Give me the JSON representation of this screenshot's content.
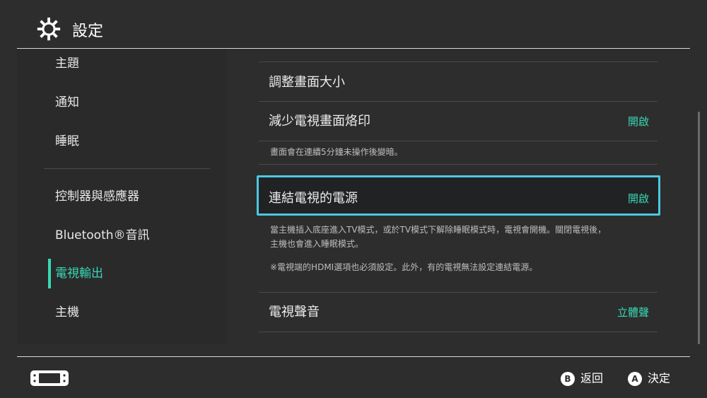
{
  "header": {
    "title": "設定",
    "icon": "gear-icon"
  },
  "sidebar": {
    "items": [
      {
        "label": "主題"
      },
      {
        "label": "通知"
      },
      {
        "label": "睡眠"
      },
      {
        "label": "控制器與感應器"
      },
      {
        "label": "Bluetooth®音訊"
      },
      {
        "label": "電視輸出",
        "active": true
      },
      {
        "label": "主機"
      }
    ]
  },
  "main": {
    "rows": [
      {
        "label": "調整畫面大小",
        "value": ""
      },
      {
        "label": "減少電視畫面烙印",
        "value": "開啟",
        "desc": "畫面會在連續5分鐘未操作後變暗。"
      },
      {
        "label": "連結電視的電源",
        "value": "開啟",
        "selected": true,
        "desc_lines": [
          "當主機插入底座進入TV模式，或於TV模式下解除睡眠模式時，電視會開機。關閉電視後，",
          "主機也會進入睡眠模式。"
        ],
        "note": "※電視端的HDMI選項也必須設定。此外，有的電視無法設定連結電源。"
      },
      {
        "label": "電視聲音",
        "value": "立體聲"
      }
    ]
  },
  "footer": {
    "back": {
      "key": "B",
      "label": "返回"
    },
    "confirm": {
      "key": "A",
      "label": "決定"
    }
  },
  "colors": {
    "accent": "#38d8b4",
    "highlight": "#4cc8e0",
    "background": "#2d2d2d"
  }
}
